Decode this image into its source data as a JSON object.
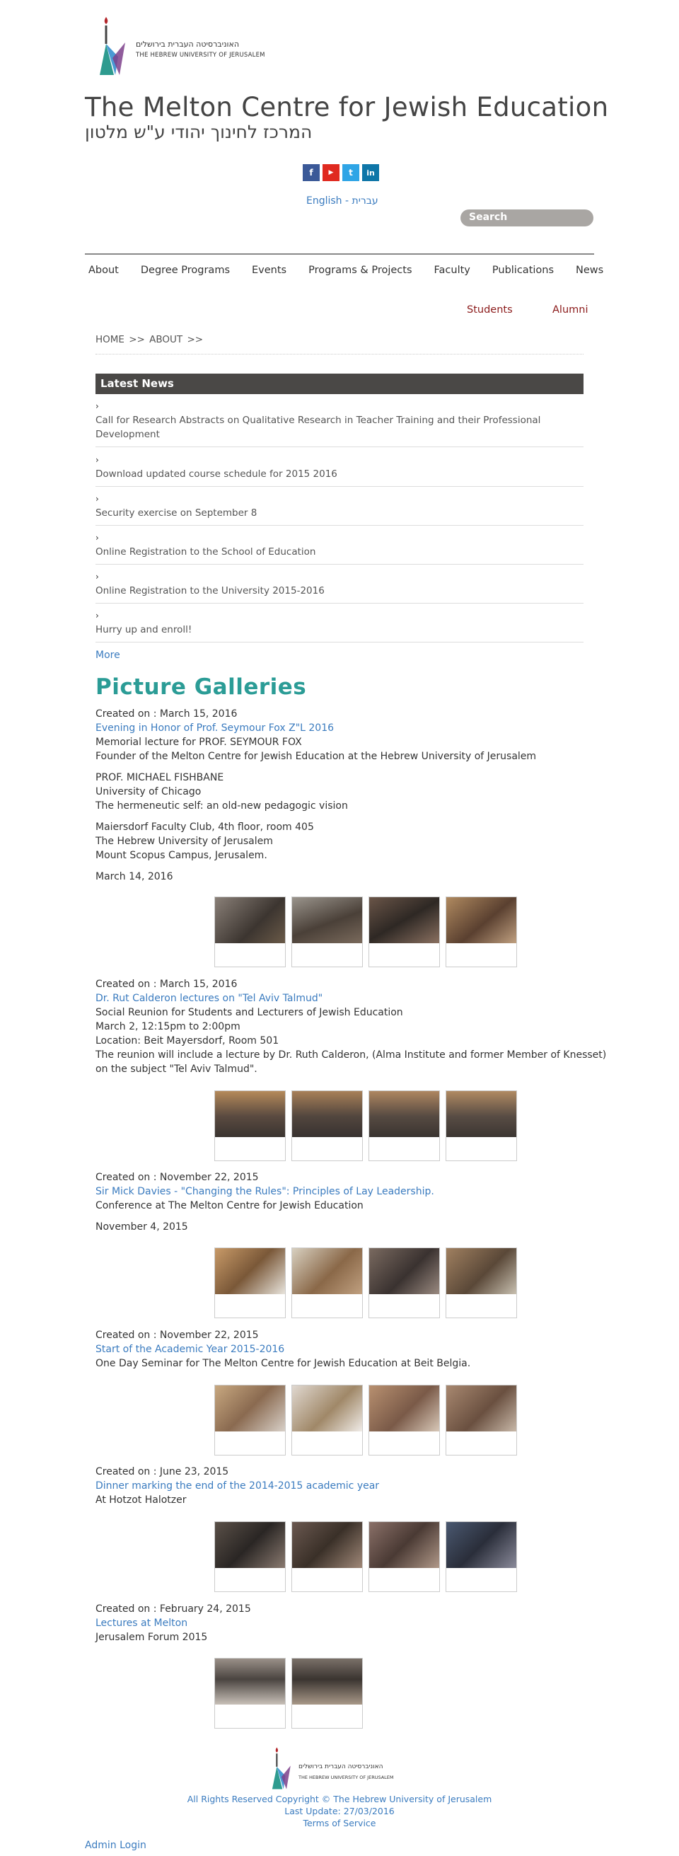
{
  "logo": {
    "hebrew": "האוניברסיטה העברית בירושלים",
    "english": "THE HEBREW UNIVERSITY OF JERUSALEM"
  },
  "site_title": "The Melton Centre for Jewish Education",
  "site_subtitle": "המרכז לחינוך יהודי ע\"ש מלטון",
  "social": [
    {
      "icon": "facebook-icon",
      "glyph": "f",
      "color": "#3b5998"
    },
    {
      "icon": "youtube-icon",
      "glyph": "▶",
      "color": "#e02a20"
    },
    {
      "icon": "twitter-icon",
      "glyph": "t",
      "color": "#2fa5e6"
    },
    {
      "icon": "linkedin-icon",
      "glyph": "in",
      "color": "#0e76a8"
    }
  ],
  "lang": {
    "english": "English",
    "sep": " - ",
    "hebrew": "עברית"
  },
  "search": {
    "placeholder": "Search"
  },
  "nav": [
    "About",
    "Degree Programs",
    "Events",
    "Programs & Projects",
    "Faculty",
    "Publications",
    "News"
  ],
  "subnav": {
    "students": "Students",
    "alumni": "Alumni"
  },
  "breadcrumb": "HOME >>   ABOUT >>",
  "news": {
    "heading": "Latest News",
    "items": [
      "Call for Research Abstracts on Qualitative Research in Teacher Training and their Professional Development",
      "Download updated course schedule for 2015 2016",
      "Security exercise on September 8",
      "Online Registration to the School of Education",
      "Online Registration to the University 2015-2016",
      "Hurry up and enroll!"
    ],
    "more": "More"
  },
  "galleries_title": "Picture Galleries",
  "galleries": [
    {
      "created": "Created on : March 15, 2016",
      "title": "Evening in Honor of Prof. Seymour Fox Z\"L 2016",
      "lines": [
        "Memorial lecture for PROF. SEYMOUR FOX",
        "Founder of the Melton Centre for Jewish Education at the Hebrew University of Jerusalem",
        "",
        "PROF. MICHAEL FISHBANE",
        "University of Chicago",
        "The hermeneutic self: an old-new pedagogic vision",
        "",
        "Maiersdorf Faculty Club, 4th floor, room 405",
        "The Hebrew University of Jerusalem",
        "Mount Scopus Campus, Jerusalem.",
        "",
        "March 14, 2016"
      ]
    },
    {
      "created": "Created on : March 15, 2016",
      "title": "Dr. Rut Calderon lectures on \"Tel Aviv Talmud\"",
      "lines": [
        "Social Reunion for Students and Lecturers of Jewish Education",
        "March 2, 12:15pm to 2:00pm",
        "Location: Beit Mayersdorf, Room 501",
        "The reunion will include a lecture by Dr. Ruth Calderon, (Alma Institute and former Member of Knesset)",
        "on the subject \"Tel Aviv Talmud\"."
      ]
    },
    {
      "created": "Created on : November 22, 2015",
      "title": "Sir Mick Davies - \"Changing the Rules\": Principles of Lay Leadership.",
      "lines": [
        "Conference at The Melton Centre for Jewish Education",
        "",
        "November 4, 2015"
      ]
    },
    {
      "created": "Created on : November 22, 2015",
      "title": "Start of the Academic Year 2015-2016",
      "lines": [
        "One Day Seminar for The Melton Centre for Jewish Education at Beit Belgia."
      ]
    },
    {
      "created": "Created on : June 23, 2015",
      "title": "Dinner marking the end of the 2014-2015 academic year",
      "lines": [
        "At Hotzot Halotzer"
      ]
    },
    {
      "created": "Created on : February 24, 2015",
      "title": "Lectures at Melton",
      "lines": [
        "Jerusalem Forum 2015"
      ]
    }
  ],
  "footer": {
    "copyright": "All Rights Reserved Copyright © The Hebrew University of Jerusalem",
    "updated": "Last Update: 27/03/2016",
    "terms": "Terms of Service",
    "admin": "Admin Login"
  }
}
